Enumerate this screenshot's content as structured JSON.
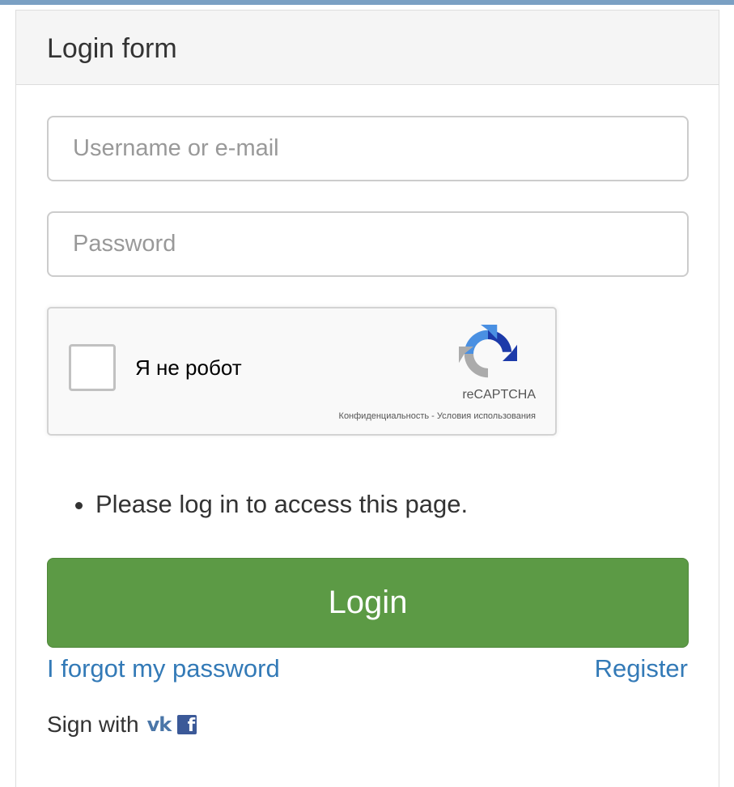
{
  "panel": {
    "title": "Login form"
  },
  "form": {
    "username_placeholder": "Username or e-mail",
    "username_value": "",
    "password_placeholder": "Password",
    "password_value": ""
  },
  "recaptcha": {
    "label": "Я не робот",
    "brand": "reCAPTCHA",
    "privacy_link": "Конфиденциальность",
    "separator": " - ",
    "terms_link": "Условия использования",
    "checked": false,
    "logo_icon": "recaptcha-logo-icon"
  },
  "messages": [
    "Please log in to access this page."
  ],
  "buttons": {
    "login_label": "Login"
  },
  "links": {
    "forgot": "I forgot my password",
    "register": "Register"
  },
  "social": {
    "label": "Sign with",
    "vk_glyph": "vk",
    "fb_glyph": "f",
    "icons": [
      "vk-icon",
      "facebook-icon"
    ]
  },
  "colors": {
    "primary_button": "#5c9a45",
    "link": "#337ab7",
    "heading_bg": "#f5f5f5",
    "vk_brand": "#4a76a8",
    "facebook_brand": "#3b5998"
  }
}
